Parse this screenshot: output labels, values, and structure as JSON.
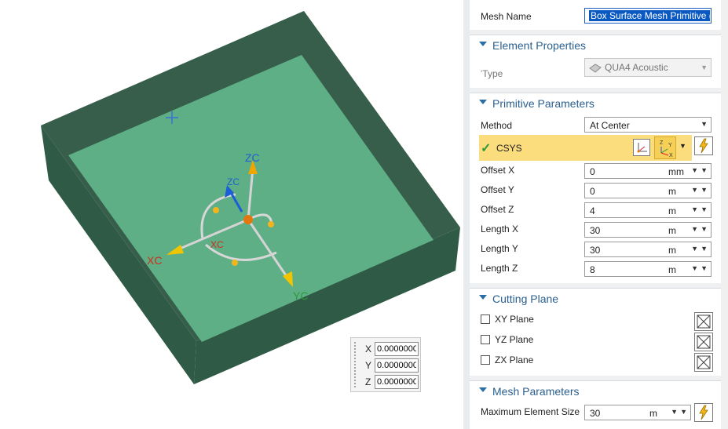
{
  "viewport": {
    "axis_labels": {
      "zc": "ZC",
      "zc_small": "ZC",
      "xc": "XC",
      "xc_small": "XC",
      "yc": "YC"
    },
    "coord_input": [
      {
        "label": "X",
        "value": "0.0000000"
      },
      {
        "label": "Y",
        "value": "0.0000000"
      },
      {
        "label": "Z",
        "value": "0.0000000"
      }
    ],
    "colors": {
      "box_floor": "#5eaf86",
      "box_wall_dark": "#365e4a",
      "box_wall_mid": "#2f5a45"
    }
  },
  "panel": {
    "mesh_name": {
      "label": "Mesh Name",
      "value": "Box Surface Mesh Primitive ("
    },
    "element_properties": {
      "title": "Element Properties",
      "type_label": "Type",
      "type_value": "QUA4 Acoustic"
    },
    "primitive_parameters": {
      "title": "Primitive Parameters",
      "method_label": "Method",
      "method_value": "At Center",
      "csys_label": "CSYS",
      "fields": [
        {
          "label": "Offset X",
          "value": "0",
          "unit": "mm"
        },
        {
          "label": "Offset Y",
          "value": "0",
          "unit": "m"
        },
        {
          "label": "Offset Z",
          "value": "4",
          "unit": "m"
        },
        {
          "label": "Length X",
          "value": "30",
          "unit": "m"
        },
        {
          "label": "Length Y",
          "value": "30",
          "unit": "m"
        },
        {
          "label": "Length Z",
          "value": "8",
          "unit": "m"
        }
      ]
    },
    "cutting_plane": {
      "title": "Cutting Plane",
      "planes": [
        {
          "label": "XY Plane"
        },
        {
          "label": "YZ Plane"
        },
        {
          "label": "ZX Plane"
        }
      ]
    },
    "mesh_parameters": {
      "title": "Mesh Parameters",
      "max_size_label": "Maximum Element Size",
      "max_size_value": "30",
      "max_size_unit": "m"
    },
    "colors": {
      "accent": "#2a5f8f",
      "csys_highlight": "#fbdd7e",
      "selection": "#0a59c2"
    }
  }
}
